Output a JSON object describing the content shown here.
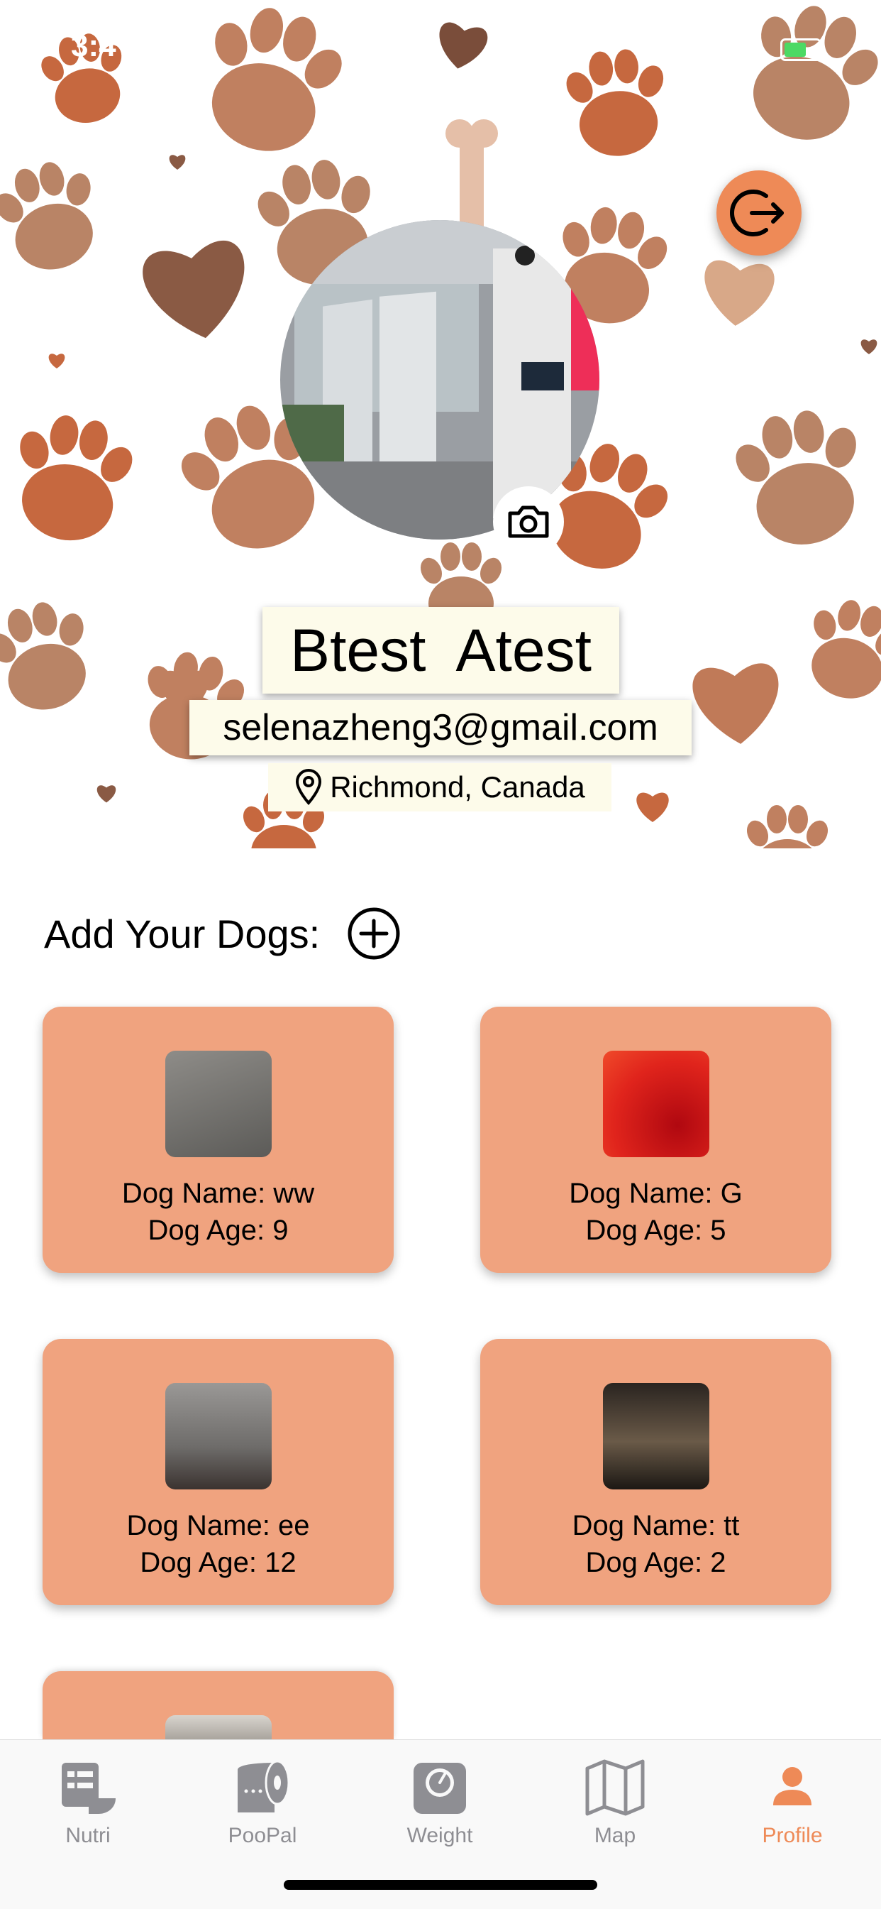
{
  "status": {
    "time": "3:4"
  },
  "profile": {
    "name": "Btest  Atest",
    "email": "selenazheng3@gmail.com",
    "location": "Richmond, Canada"
  },
  "dogs_section": {
    "title": "Add Your Dogs:"
  },
  "dogs": [
    {
      "name_line": "Dog Name: ww",
      "age_line": "Dog Age: 9"
    },
    {
      "name_line": "Dog Name: G",
      "age_line": "Dog Age: 5"
    },
    {
      "name_line": "Dog Name: ee",
      "age_line": "Dog Age: 12"
    },
    {
      "name_line": "Dog Name: tt",
      "age_line": "Dog Age: 2"
    }
  ],
  "tabs": [
    {
      "label": "Nutri",
      "icon": "food-list-icon"
    },
    {
      "label": "PooPal",
      "icon": "toilet-roll-icon"
    },
    {
      "label": "Weight",
      "icon": "scale-icon"
    },
    {
      "label": "Map",
      "icon": "map-icon"
    },
    {
      "label": "Profile",
      "icon": "person-icon",
      "active": true
    }
  ],
  "colors": {
    "accent": "#ee8a57",
    "card": "#f0a37f",
    "paw_dark": "#c6683f",
    "paw_light": "#b98466",
    "heart": "#8a5a44"
  }
}
